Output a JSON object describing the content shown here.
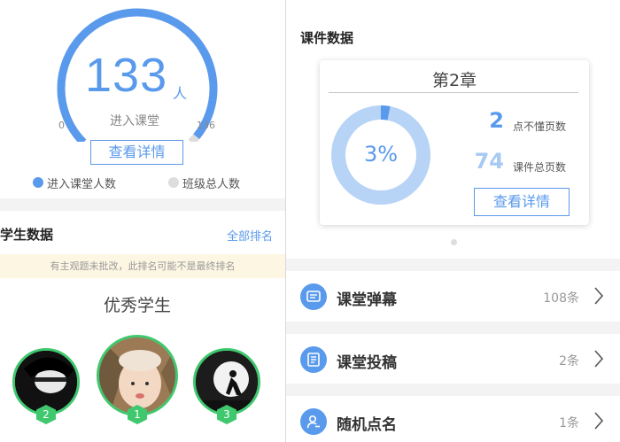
{
  "classroom": {
    "entered_count": "133",
    "unit": "人",
    "caption": "进入课堂",
    "gauge_min": "0",
    "gauge_max": "136",
    "detail_label": "查看详情",
    "legend_entered": "进入课堂人数",
    "legend_total": "班级总人数",
    "entered_value": 133,
    "max_value": 136,
    "accent_color": "#5a9aec",
    "track_color": "#dddddd"
  },
  "student_data": {
    "title": "学生数据",
    "all_rank_label": "全部排名",
    "notice": "有主观题未批改，此排名可能不是最终排名",
    "excellent_title": "优秀学生",
    "ranks": [
      "2",
      "1",
      "3"
    ],
    "badge_color": "#3fc86e"
  },
  "courseware": {
    "title": "课件数据",
    "chapter": "第2章",
    "percent_label": "3%",
    "percent_value": 0.03,
    "not_understood_count": "2",
    "not_understood_label": "点不懂页数",
    "total_pages_count": "74",
    "total_pages_label": "课件总页数",
    "detail_label": "查看详情"
  },
  "list": [
    {
      "label": "课堂弹幕",
      "count": "108条",
      "icon": "danmaku-icon"
    },
    {
      "label": "课堂投稿",
      "count": "2条",
      "icon": "submission-icon"
    },
    {
      "label": "随机点名",
      "count": "1条",
      "icon": "random-rollcall-icon"
    }
  ]
}
